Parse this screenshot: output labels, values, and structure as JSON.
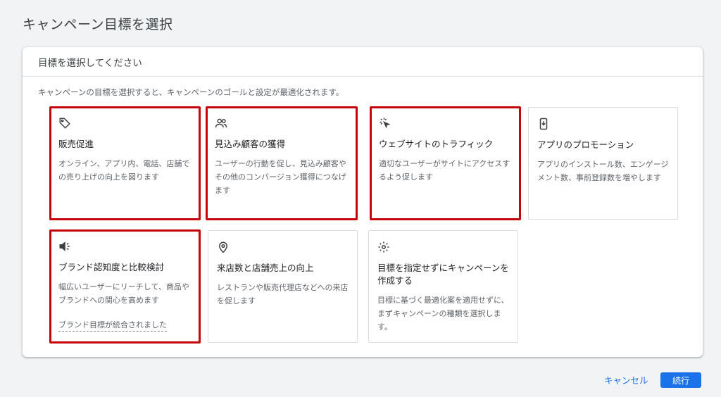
{
  "page": {
    "title": "キャンペーン目標を選択"
  },
  "panel": {
    "header": "目標を選択してください",
    "description": "キャンペーンの目標を選択すると、キャンペーンのゴールと設定が最適化されます。"
  },
  "goals": [
    {
      "icon": "tag-icon",
      "title": "販売促進",
      "desc": "オンライン、アプリ内、電話、店舗での売り上げの向上を図ります",
      "highlighted": true
    },
    {
      "icon": "people-icon",
      "title": "見込み顧客の獲得",
      "desc": "ユーザーの行動を促し、見込み顧客やその他のコンバージョン獲得につなげます",
      "highlighted": true
    },
    {
      "icon": "cursor-click-icon",
      "title": "ウェブサイトのトラフィック",
      "desc": "適切なユーザーがサイトにアクセスするよう促します",
      "highlighted": true
    },
    {
      "icon": "phone-download-icon",
      "title": "アプリのプロモーション",
      "desc": "アプリのインストール数、エンゲージメント数、事前登録数を増やします",
      "highlighted": false
    },
    {
      "icon": "megaphone-icon",
      "title": "ブランド認知度と比較検討",
      "desc": "幅広いユーザーにリーチして、商品やブランドへの関心を高めます",
      "note": "ブランド目標が統合されました",
      "highlighted": true
    },
    {
      "icon": "location-pin-icon",
      "title": "来店数と店舗売上の向上",
      "desc": "レストランや販売代理店などへの来店を促します",
      "highlighted": false
    },
    {
      "icon": "gear-icon",
      "title": "目標を指定せずにキャンペーンを作成する",
      "desc": "目標に基づく最適化案を適用せずに、まずキャンペーンの種類を選択します。",
      "highlighted": false
    }
  ],
  "footer": {
    "cancel_label": "キャンセル",
    "continue_label": "続行"
  },
  "colors": {
    "accent": "#1a73e8",
    "highlight_border": "#c5050c"
  }
}
